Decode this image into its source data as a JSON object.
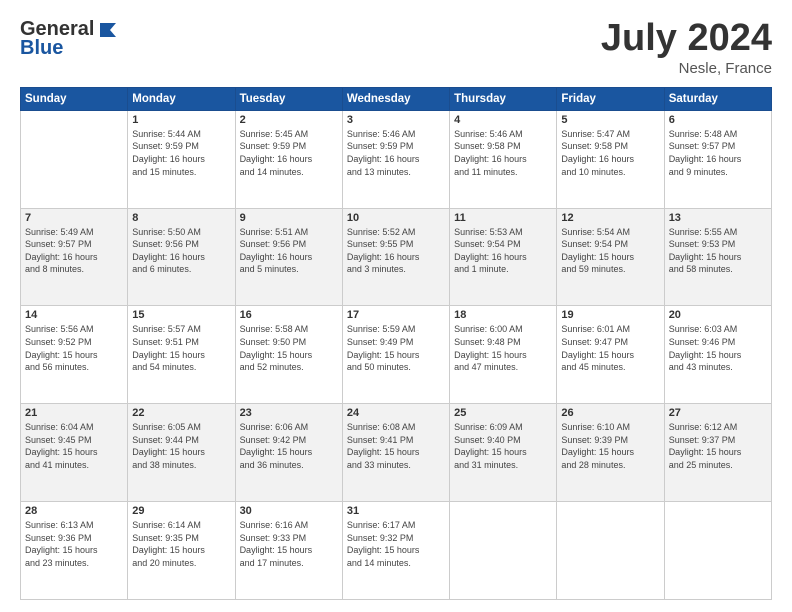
{
  "header": {
    "logo_general": "General",
    "logo_blue": "Blue",
    "month_year": "July 2024",
    "location": "Nesle, France"
  },
  "days_of_week": [
    "Sunday",
    "Monday",
    "Tuesday",
    "Wednesday",
    "Thursday",
    "Friday",
    "Saturday"
  ],
  "weeks": [
    [
      {
        "day": "",
        "info": ""
      },
      {
        "day": "1",
        "info": "Sunrise: 5:44 AM\nSunset: 9:59 PM\nDaylight: 16 hours\nand 15 minutes."
      },
      {
        "day": "2",
        "info": "Sunrise: 5:45 AM\nSunset: 9:59 PM\nDaylight: 16 hours\nand 14 minutes."
      },
      {
        "day": "3",
        "info": "Sunrise: 5:46 AM\nSunset: 9:59 PM\nDaylight: 16 hours\nand 13 minutes."
      },
      {
        "day": "4",
        "info": "Sunrise: 5:46 AM\nSunset: 9:58 PM\nDaylight: 16 hours\nand 11 minutes."
      },
      {
        "day": "5",
        "info": "Sunrise: 5:47 AM\nSunset: 9:58 PM\nDaylight: 16 hours\nand 10 minutes."
      },
      {
        "day": "6",
        "info": "Sunrise: 5:48 AM\nSunset: 9:57 PM\nDaylight: 16 hours\nand 9 minutes."
      }
    ],
    [
      {
        "day": "7",
        "info": "Sunrise: 5:49 AM\nSunset: 9:57 PM\nDaylight: 16 hours\nand 8 minutes."
      },
      {
        "day": "8",
        "info": "Sunrise: 5:50 AM\nSunset: 9:56 PM\nDaylight: 16 hours\nand 6 minutes."
      },
      {
        "day": "9",
        "info": "Sunrise: 5:51 AM\nSunset: 9:56 PM\nDaylight: 16 hours\nand 5 minutes."
      },
      {
        "day": "10",
        "info": "Sunrise: 5:52 AM\nSunset: 9:55 PM\nDaylight: 16 hours\nand 3 minutes."
      },
      {
        "day": "11",
        "info": "Sunrise: 5:53 AM\nSunset: 9:54 PM\nDaylight: 16 hours\nand 1 minute."
      },
      {
        "day": "12",
        "info": "Sunrise: 5:54 AM\nSunset: 9:54 PM\nDaylight: 15 hours\nand 59 minutes."
      },
      {
        "day": "13",
        "info": "Sunrise: 5:55 AM\nSunset: 9:53 PM\nDaylight: 15 hours\nand 58 minutes."
      }
    ],
    [
      {
        "day": "14",
        "info": "Sunrise: 5:56 AM\nSunset: 9:52 PM\nDaylight: 15 hours\nand 56 minutes."
      },
      {
        "day": "15",
        "info": "Sunrise: 5:57 AM\nSunset: 9:51 PM\nDaylight: 15 hours\nand 54 minutes."
      },
      {
        "day": "16",
        "info": "Sunrise: 5:58 AM\nSunset: 9:50 PM\nDaylight: 15 hours\nand 52 minutes."
      },
      {
        "day": "17",
        "info": "Sunrise: 5:59 AM\nSunset: 9:49 PM\nDaylight: 15 hours\nand 50 minutes."
      },
      {
        "day": "18",
        "info": "Sunrise: 6:00 AM\nSunset: 9:48 PM\nDaylight: 15 hours\nand 47 minutes."
      },
      {
        "day": "19",
        "info": "Sunrise: 6:01 AM\nSunset: 9:47 PM\nDaylight: 15 hours\nand 45 minutes."
      },
      {
        "day": "20",
        "info": "Sunrise: 6:03 AM\nSunset: 9:46 PM\nDaylight: 15 hours\nand 43 minutes."
      }
    ],
    [
      {
        "day": "21",
        "info": "Sunrise: 6:04 AM\nSunset: 9:45 PM\nDaylight: 15 hours\nand 41 minutes."
      },
      {
        "day": "22",
        "info": "Sunrise: 6:05 AM\nSunset: 9:44 PM\nDaylight: 15 hours\nand 38 minutes."
      },
      {
        "day": "23",
        "info": "Sunrise: 6:06 AM\nSunset: 9:42 PM\nDaylight: 15 hours\nand 36 minutes."
      },
      {
        "day": "24",
        "info": "Sunrise: 6:08 AM\nSunset: 9:41 PM\nDaylight: 15 hours\nand 33 minutes."
      },
      {
        "day": "25",
        "info": "Sunrise: 6:09 AM\nSunset: 9:40 PM\nDaylight: 15 hours\nand 31 minutes."
      },
      {
        "day": "26",
        "info": "Sunrise: 6:10 AM\nSunset: 9:39 PM\nDaylight: 15 hours\nand 28 minutes."
      },
      {
        "day": "27",
        "info": "Sunrise: 6:12 AM\nSunset: 9:37 PM\nDaylight: 15 hours\nand 25 minutes."
      }
    ],
    [
      {
        "day": "28",
        "info": "Sunrise: 6:13 AM\nSunset: 9:36 PM\nDaylight: 15 hours\nand 23 minutes."
      },
      {
        "day": "29",
        "info": "Sunrise: 6:14 AM\nSunset: 9:35 PM\nDaylight: 15 hours\nand 20 minutes."
      },
      {
        "day": "30",
        "info": "Sunrise: 6:16 AM\nSunset: 9:33 PM\nDaylight: 15 hours\nand 17 minutes."
      },
      {
        "day": "31",
        "info": "Sunrise: 6:17 AM\nSunset: 9:32 PM\nDaylight: 15 hours\nand 14 minutes."
      },
      {
        "day": "",
        "info": ""
      },
      {
        "day": "",
        "info": ""
      },
      {
        "day": "",
        "info": ""
      }
    ]
  ]
}
